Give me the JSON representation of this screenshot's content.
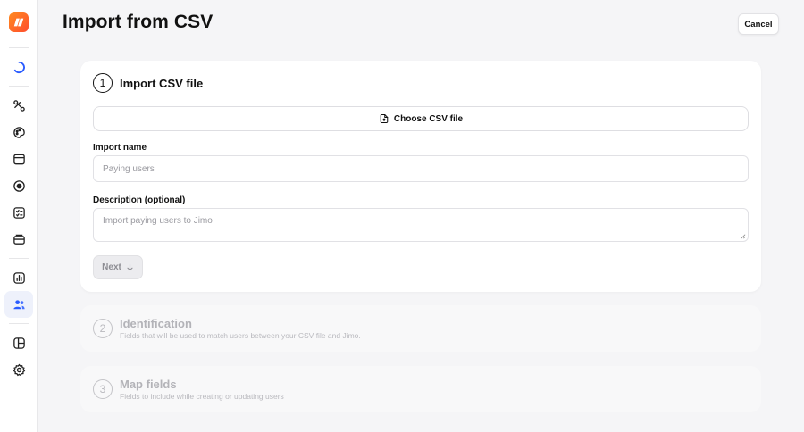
{
  "app": {
    "logo": "jimo-logo"
  },
  "sidebar": {
    "items": [
      {
        "name": "loading-icon"
      },
      {
        "name": "tours-icon"
      },
      {
        "name": "palette-icon"
      },
      {
        "name": "window-icon"
      },
      {
        "name": "record-icon"
      },
      {
        "name": "checklist-icon"
      },
      {
        "name": "stack-icon"
      },
      {
        "name": "analytics-icon"
      },
      {
        "name": "users-icon",
        "active": true
      },
      {
        "name": "layout-icon"
      },
      {
        "name": "settings-icon"
      }
    ]
  },
  "header": {
    "title": "Import from CSV",
    "cancel_label": "Cancel"
  },
  "steps": [
    {
      "number": "1",
      "title": "Import CSV file",
      "choose_label": "Choose CSV file",
      "import_name_label": "Import name",
      "import_name_placeholder": "Paying users",
      "description_label": "Description (optional)",
      "description_placeholder": "Import paying users to Jimo",
      "next_label": "Next"
    },
    {
      "number": "2",
      "title": "Identification",
      "description": "Fields that will be used to match users between your CSV file and Jimo."
    },
    {
      "number": "3",
      "title": "Map fields",
      "description": "Fields to include while creating or updating users"
    }
  ],
  "colors": {
    "brand": "#ff6a26",
    "accent": "#2a5cff"
  }
}
